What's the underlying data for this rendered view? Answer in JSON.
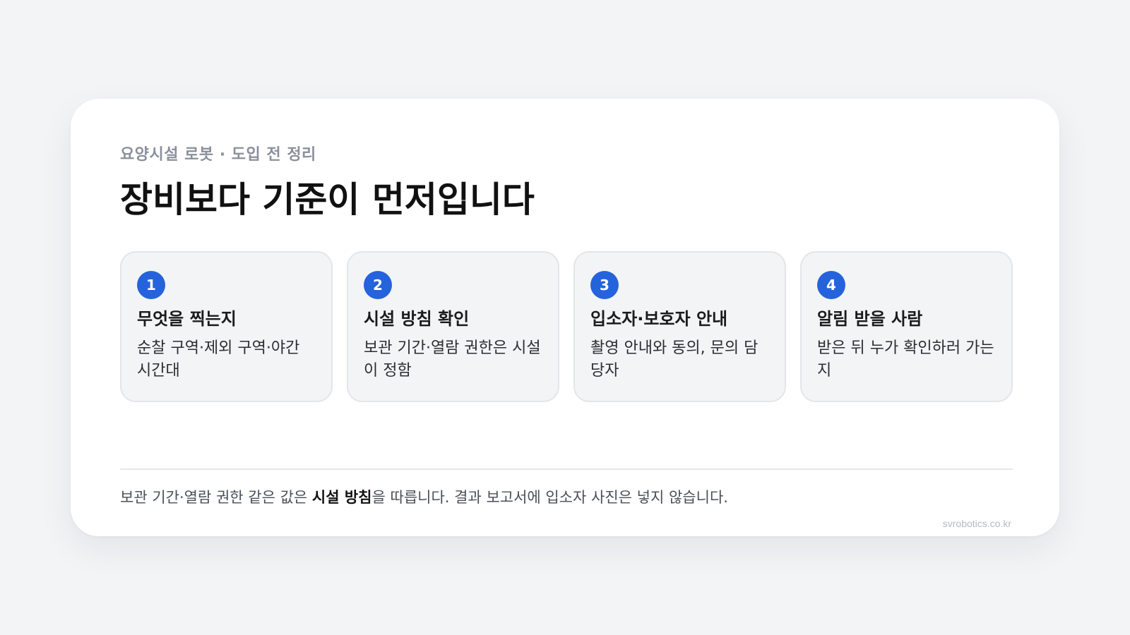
{
  "header": {
    "eyebrow": "요양시설 로봇 · 도입 전 정리",
    "title": "장비보다 기준이 먼저입니다"
  },
  "steps": [
    {
      "number": "1",
      "title": "무엇을 찍는지",
      "description": "순찰 구역·제외 구역·야간 시간대"
    },
    {
      "number": "2",
      "title": "시설 방침 확인",
      "description": "보관 기간·열람 권한은 시설이 정함"
    },
    {
      "number": "3",
      "title": "입소자·보호자 안내",
      "description": "촬영 안내와 동의, 문의 담당자"
    },
    {
      "number": "4",
      "title": "알림 받을 사람",
      "description": "받은 뒤 누가 확인하러 가는지"
    }
  ],
  "footer": {
    "note_before": "보관 기간·열람 권한 같은 값은 ",
    "note_emphasis": "시설 방침",
    "note_after": "을 따릅니다. 결과 보고서에 입소자 사진은 넣지 않습니다.",
    "domain": "svrobotics.co.kr"
  },
  "colors": {
    "accent": "#2563dc",
    "page_background": "#f3f4f6",
    "card_background": "#ffffff",
    "step_background": "#f3f4f6"
  }
}
